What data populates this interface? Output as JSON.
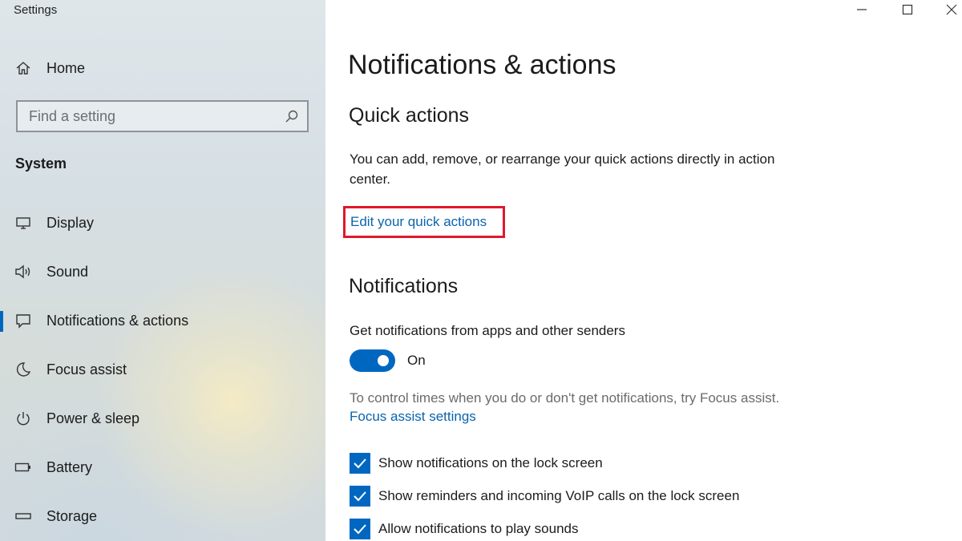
{
  "window": {
    "title": "Settings"
  },
  "sidebar": {
    "home_label": "Home",
    "search_placeholder": "Find a setting",
    "section_label": "System",
    "items": [
      {
        "label": "Display",
        "icon": "display-icon"
      },
      {
        "label": "Sound",
        "icon": "sound-icon"
      },
      {
        "label": "Notifications & actions",
        "icon": "notifications-icon",
        "active": true
      },
      {
        "label": "Focus assist",
        "icon": "moon-icon"
      },
      {
        "label": "Power & sleep",
        "icon": "power-icon"
      },
      {
        "label": "Battery",
        "icon": "battery-icon"
      },
      {
        "label": "Storage",
        "icon": "storage-icon"
      }
    ]
  },
  "main": {
    "title": "Notifications & actions",
    "quick_actions": {
      "heading": "Quick actions",
      "description": "You can add, remove, or rearrange your quick actions directly in action center.",
      "edit_link": "Edit your quick actions"
    },
    "notifications": {
      "heading": "Notifications",
      "get_label": "Get notifications from apps and other senders",
      "toggle_state": "On",
      "focus_hint": "To control times when you do or don't get notifications, try Focus assist.",
      "focus_link": "Focus assist settings",
      "checkboxes": [
        {
          "label": "Show notifications on the lock screen",
          "checked": true
        },
        {
          "label": "Show reminders and incoming VoIP calls on the lock screen",
          "checked": true
        },
        {
          "label": "Allow notifications to play sounds",
          "checked": true
        }
      ]
    }
  },
  "colors": {
    "accent": "#0067c0",
    "link": "#0a64ad",
    "highlight": "#e0182d"
  }
}
